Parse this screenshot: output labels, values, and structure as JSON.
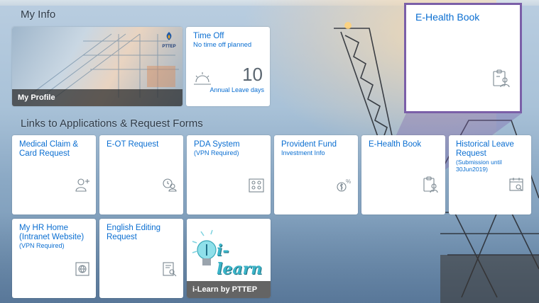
{
  "sections": {
    "my_info": "My Info",
    "links": "Links to Applications & Request Forms"
  },
  "my_profile": {
    "caption": "My Profile",
    "logo_text": "PTTEP"
  },
  "time_off": {
    "title": "Time Off",
    "subtitle": "No time off planned",
    "value": "10",
    "unit": "Annual Leave days"
  },
  "highlight": {
    "title": "E-Health Book",
    "icon": "health-book-icon"
  },
  "links_tiles": [
    {
      "title": "Medical Claim & Card Request",
      "subtitle": "",
      "icon": "add-person-icon"
    },
    {
      "title": "E-OT Request",
      "subtitle": "",
      "icon": "person-clock-icon"
    },
    {
      "title": "PDA System",
      "subtitle": "(VPN Required)",
      "icon": "network-people-icon"
    },
    {
      "title": "Provident Fund",
      "subtitle": "Investment Info",
      "icon": "money-percent-icon"
    },
    {
      "title": "E-Health Book",
      "subtitle": "",
      "icon": "health-book-icon"
    },
    {
      "title": "Historical Leave Request",
      "subtitle": "(Submission until 30Jun2019)",
      "icon": "calendar-search-icon"
    },
    {
      "title": "My HR Home (Intranet Website)",
      "subtitle": "(VPN Required)",
      "icon": "globe-screen-icon"
    },
    {
      "title": "English Editing Request",
      "subtitle": "",
      "icon": "document-search-icon"
    }
  ],
  "ilearn": {
    "caption": "i-Learn by PTTEP",
    "logo_text": "i-learn"
  },
  "colors": {
    "accent": "#0a6ed1",
    "highlight_border": "#7b5fa8"
  }
}
